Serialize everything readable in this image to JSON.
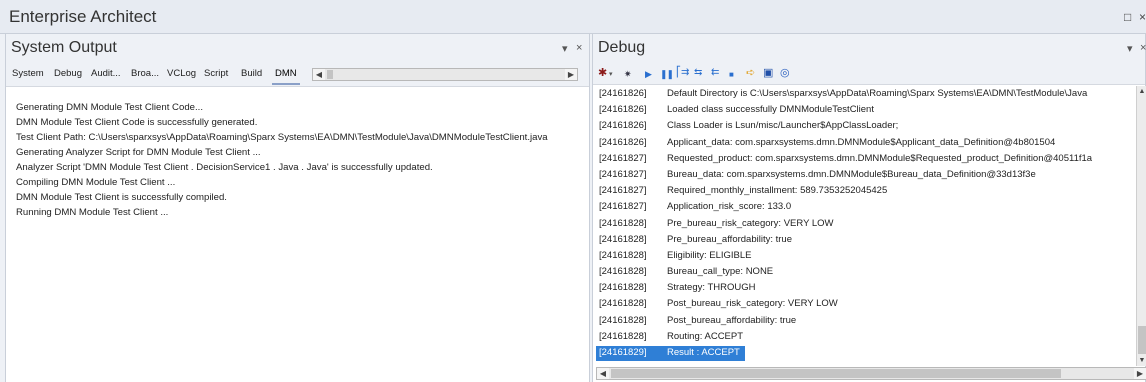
{
  "app": {
    "title": "Enterprise Architect",
    "restore_glyph": "□",
    "close_glyph": "×"
  },
  "output_panel": {
    "title": "System Output",
    "dropdown_glyph": "▾",
    "close_glyph": "×",
    "tabs": [
      "System",
      "Debug",
      "Audit...",
      "Broa...",
      "VCLog",
      "Script",
      "Build",
      "DMN"
    ],
    "active_tab": "DMN",
    "lines": [
      "Generating DMN Module Test Client Code...",
      "DMN Module Test Client Code is successfully generated.",
      "Test Client Path: C:\\Users\\sparxsys\\AppData\\Roaming\\Sparx Systems\\EA\\DMN\\TestModule\\Java\\DMNModuleTestClient.java",
      "Generating Analyzer Script for DMN Module Test Client ...",
      "Analyzer Script 'DMN Module Test Client . DecisionService1 . Java . Java' is successfully updated.",
      "Compiling DMN Module Test Client ...",
      "DMN Module Test Client is successfully compiled.",
      "Running DMN Module Test Client ..."
    ]
  },
  "debug_panel": {
    "title": "Debug",
    "dropdown_glyph": "▾",
    "close_glyph": "×",
    "toolbar_icons": [
      "bug-menu-icon",
      "settings-icon",
      "run-icon",
      "pause-icon",
      "step-into-icon",
      "step-over-icon",
      "step-out-icon",
      "stop-icon",
      "pin-icon",
      "save-icon",
      "help-icon"
    ],
    "rows": [
      {
        "ts": "[24161826]",
        "msg": "Default Directory is C:\\Users\\sparxsys\\AppData\\Roaming\\Sparx Systems\\EA\\DMN\\TestModule\\Java"
      },
      {
        "ts": "[24161826]",
        "msg": "Loaded class successfully DMNModuleTestClient"
      },
      {
        "ts": "[24161826]",
        "msg": "Class Loader is Lsun/misc/Launcher$AppClassLoader;"
      },
      {
        "ts": "[24161826]",
        "msg": "Applicant_data: com.sparxsystems.dmn.DMNModule$Applicant_data_Definition@4b801504"
      },
      {
        "ts": "[24161827]",
        "msg": "Requested_product: com.sparxsystems.dmn.DMNModule$Requested_product_Definition@40511f1a"
      },
      {
        "ts": "[24161827]",
        "msg": "Bureau_data: com.sparxsystems.dmn.DMNModule$Bureau_data_Definition@33d13f3e"
      },
      {
        "ts": "[24161827]",
        "msg": "Required_monthly_installment: 589.7353252045425"
      },
      {
        "ts": "[24161827]",
        "msg": "Application_risk_score: 133.0"
      },
      {
        "ts": "[24161828]",
        "msg": "Pre_bureau_risk_category: VERY LOW"
      },
      {
        "ts": "[24161828]",
        "msg": "Pre_bureau_affordability: true"
      },
      {
        "ts": "[24161828]",
        "msg": "Eligibility: ELIGIBLE"
      },
      {
        "ts": "[24161828]",
        "msg": "Bureau_call_type: NONE"
      },
      {
        "ts": "[24161828]",
        "msg": "Strategy: THROUGH"
      },
      {
        "ts": "[24161828]",
        "msg": "Post_bureau_risk_category: VERY LOW"
      },
      {
        "ts": "[24161828]",
        "msg": "Post_bureau_affordability: true"
      },
      {
        "ts": "[24161828]",
        "msg": "Routing: ACCEPT"
      },
      {
        "ts": "[24161829]",
        "msg": "Result : ACCEPT",
        "selected": true
      }
    ]
  },
  "colors": {
    "selection": "#2f7fd6",
    "panel_bg": "#eef1f6",
    "content_bg": "#ffffff"
  }
}
